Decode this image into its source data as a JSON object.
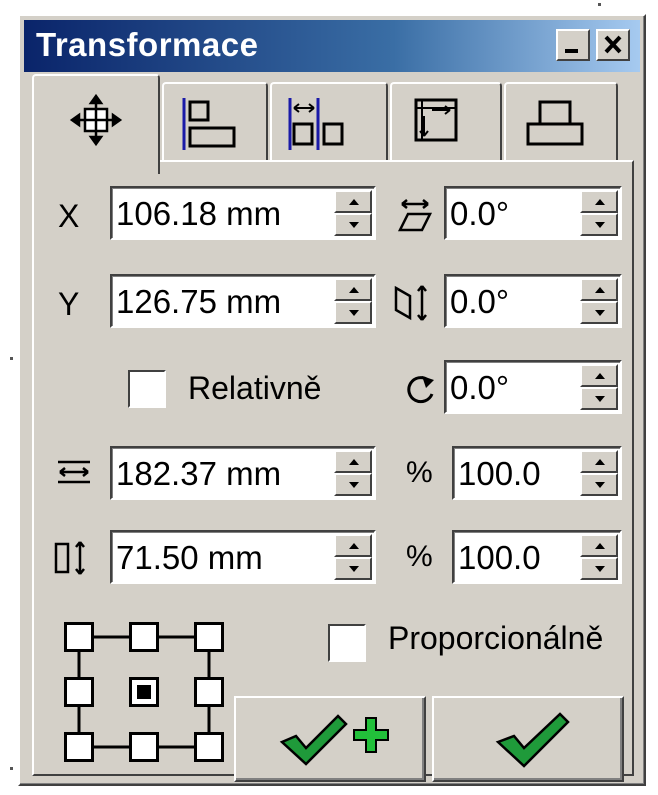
{
  "window": {
    "title": "Transformace",
    "minimize_label": "_",
    "close_label": "x"
  },
  "tabs": [
    {
      "icon": "move-icon"
    },
    {
      "icon": "align-icon"
    },
    {
      "icon": "distribute-icon"
    },
    {
      "icon": "resize-frame-icon"
    },
    {
      "icon": "group-icon"
    }
  ],
  "position": {
    "x_label": "X",
    "x_value": "106.18 mm",
    "y_label": "Y",
    "y_value": "126.75 mm",
    "relative_label": "Relativně"
  },
  "angles": {
    "skew_h_value": "0.0°",
    "skew_v_value": "0.0°",
    "rotate_value": "0.0°"
  },
  "size": {
    "width_value": "182.37 mm",
    "height_value": "71.50 mm",
    "percent_label": "%",
    "width_percent": "100.0",
    "height_percent": "100.0",
    "proportional_label": "Proporcionálně"
  }
}
